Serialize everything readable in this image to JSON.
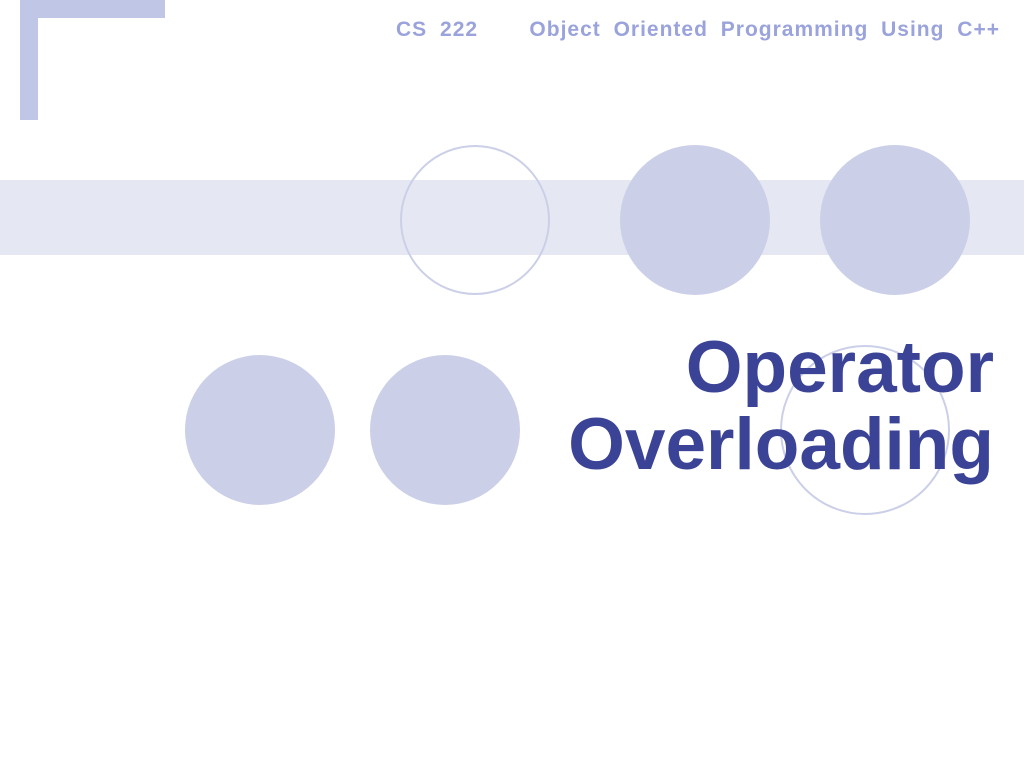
{
  "header": {
    "course_code": "CS 222",
    "course_title": "Object  Oriented  Programming  Using C++"
  },
  "slide": {
    "title_line1": "Operator",
    "title_line2": "Overloading"
  },
  "colors": {
    "accent_light": "#c0c6e6",
    "accent_pale": "#e5e7f2",
    "circle_fill": "#cbcfe8",
    "title_color": "#3b4397",
    "header_text": "#9aa3db"
  }
}
